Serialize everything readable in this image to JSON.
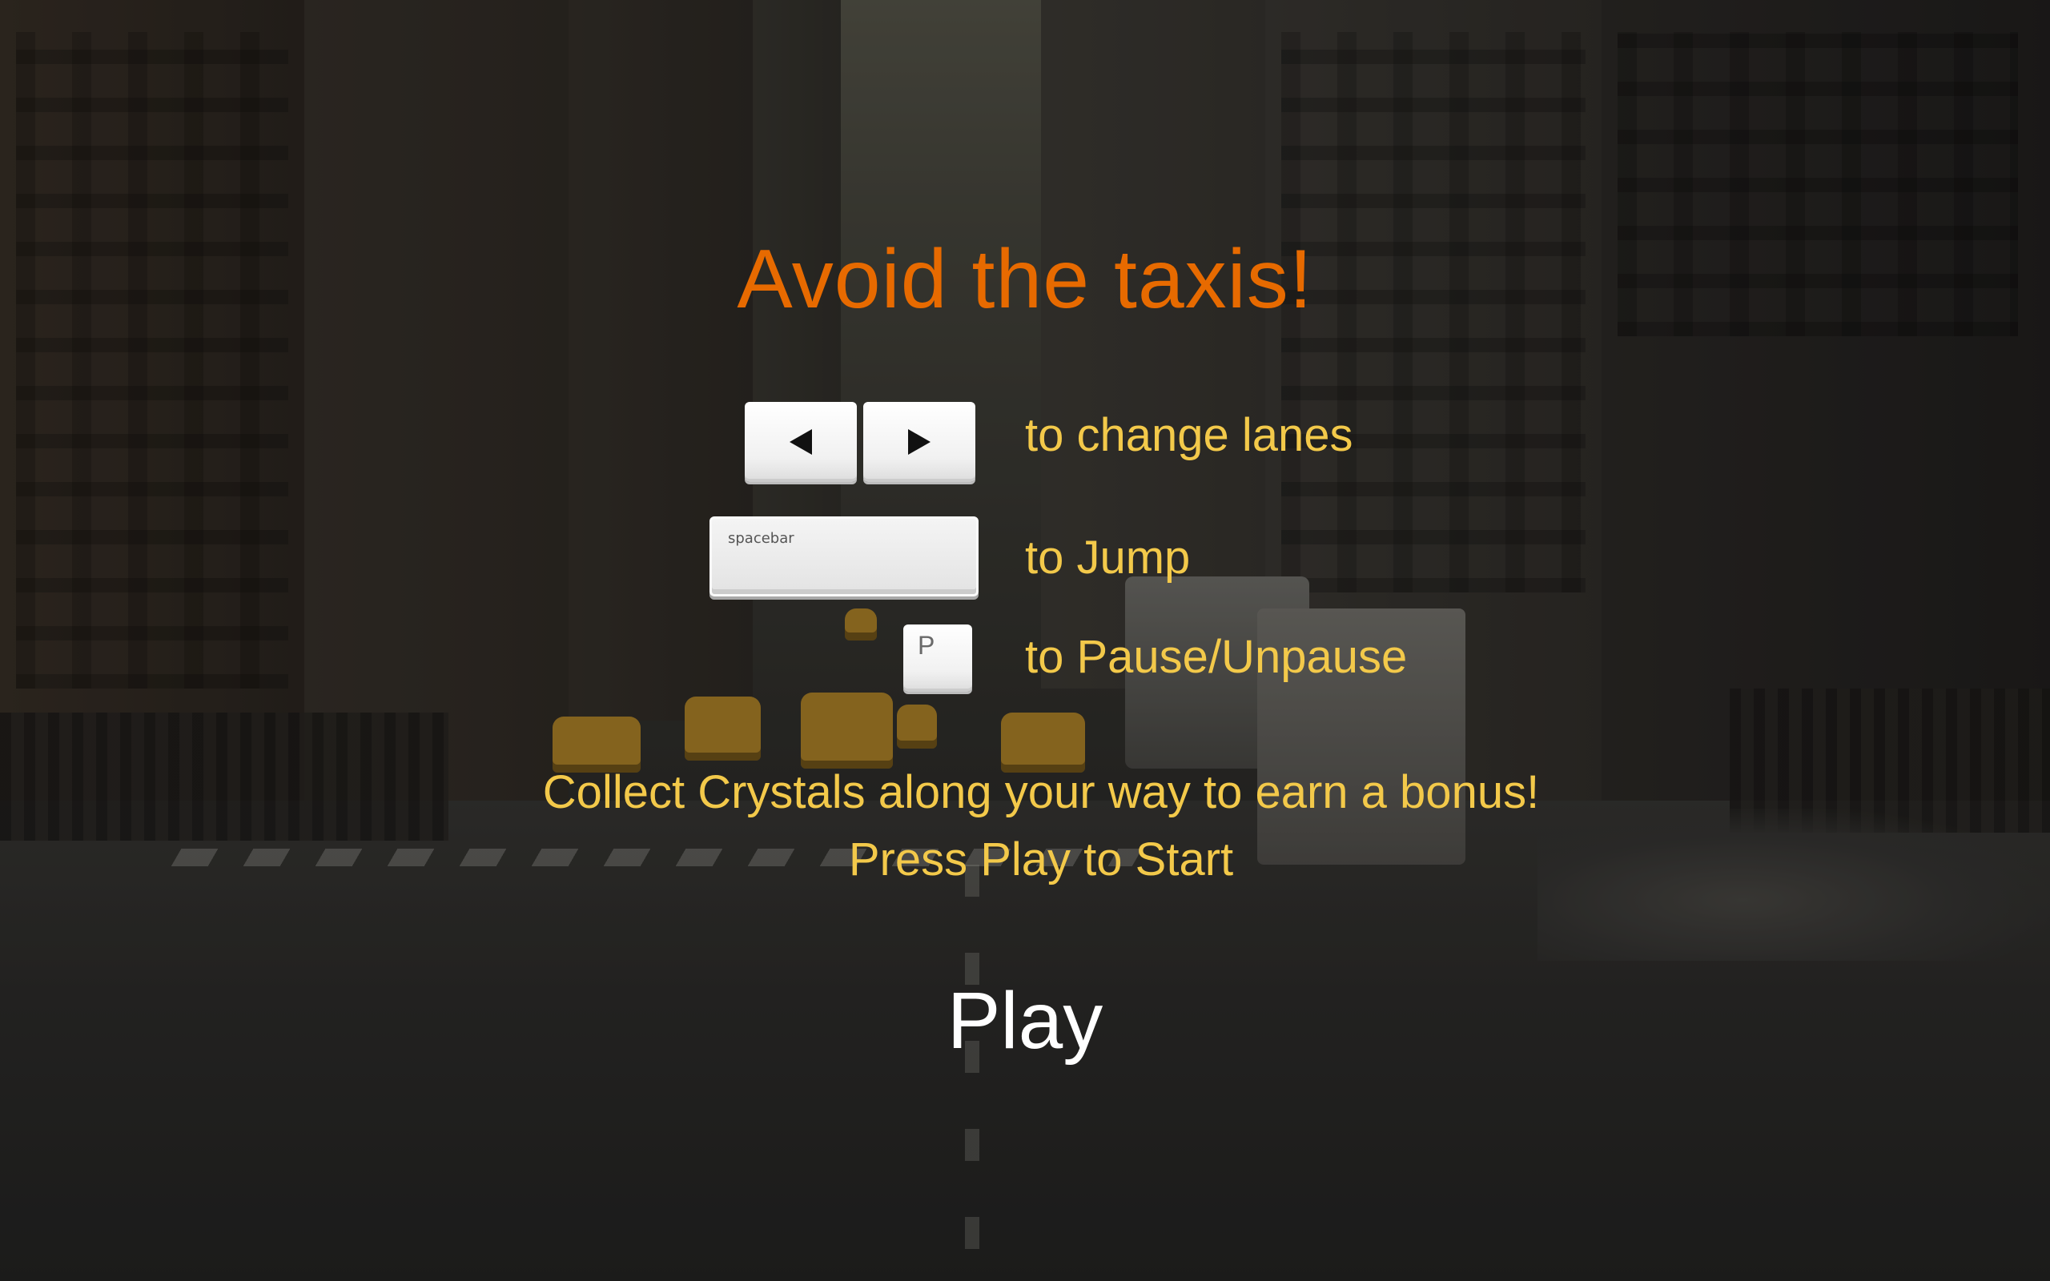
{
  "title": "Avoid the taxis!",
  "controls": {
    "change_lanes": {
      "keys": [
        "left-arrow-icon",
        "right-arrow-icon"
      ],
      "text": "to change lanes"
    },
    "jump": {
      "key_label": "spacebar",
      "text": "to Jump"
    },
    "pause": {
      "key_label": "P",
      "text": "to Pause/Unpause"
    }
  },
  "messages": {
    "bonus": "Collect Crystals along your way to earn a bonus!",
    "start_hint": "Press Play to Start"
  },
  "play_button": {
    "label": "Play"
  },
  "colors": {
    "title": "#e76a00",
    "instruction_text": "#f3c94a",
    "play_text": "#ffffff"
  }
}
